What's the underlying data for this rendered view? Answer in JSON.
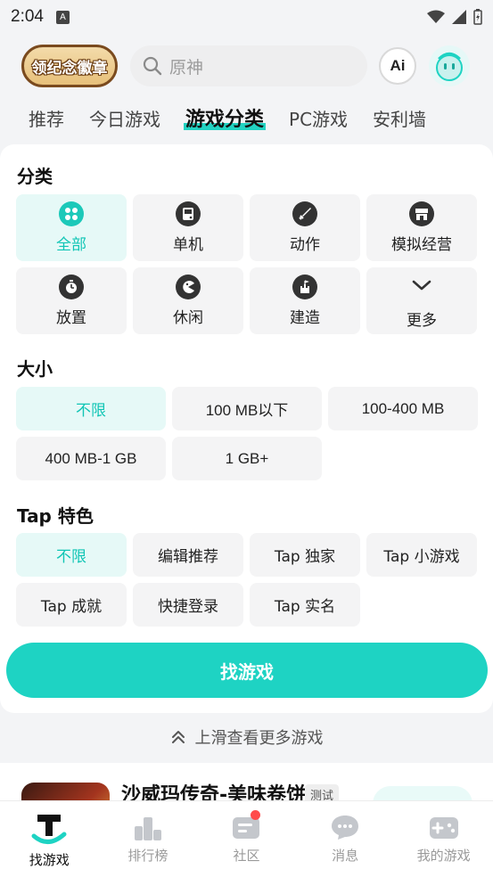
{
  "status_bar": {
    "time": "2:04"
  },
  "header": {
    "badge_label": "领纪念徽章",
    "search_placeholder": "原神",
    "ai_label": "Ai"
  },
  "tabs": [
    {
      "label": "推荐"
    },
    {
      "label": "今日游戏"
    },
    {
      "label": "游戏分类"
    },
    {
      "label": "PC游戏"
    },
    {
      "label": "安利墙"
    }
  ],
  "sections": {
    "category_title": "分类",
    "size_title": "大小",
    "tap_title": "Tap 特色"
  },
  "categories": [
    {
      "label": "全部",
      "icon": "grid-icon"
    },
    {
      "label": "单机",
      "icon": "gameboy-icon"
    },
    {
      "label": "动作",
      "icon": "sword-icon"
    },
    {
      "label": "模拟经营",
      "icon": "shop-icon"
    },
    {
      "label": "放置",
      "icon": "timer-icon"
    },
    {
      "label": "休闲",
      "icon": "pacman-icon"
    },
    {
      "label": "建造",
      "icon": "castle-icon"
    },
    {
      "label": "更多",
      "icon": "chevron-down-icon"
    }
  ],
  "sizes": [
    {
      "label": "不限"
    },
    {
      "label": "100 MB以下"
    },
    {
      "label": "100-400 MB"
    },
    {
      "label": "400 MB-1 GB"
    },
    {
      "label": "1 GB+"
    }
  ],
  "tap_features": [
    {
      "label": "不限"
    },
    {
      "label": "编辑推荐"
    },
    {
      "label": "Tap 独家"
    },
    {
      "label": "Tap 小游戏"
    },
    {
      "label": "Tap 成就"
    },
    {
      "label": "快捷登录"
    },
    {
      "label": "Tap 实名"
    }
  ],
  "find_button": "找游戏",
  "swipe_hint": "上滑查看更多游戏",
  "game_peek": {
    "title": "沙威玛传奇-美味卷饼",
    "tag": "测试"
  },
  "bottom_nav": [
    {
      "label": "找游戏"
    },
    {
      "label": "排行榜"
    },
    {
      "label": "社区"
    },
    {
      "label": "消息"
    },
    {
      "label": "我的游戏"
    }
  ],
  "colors": {
    "accent": "#1ed3c3",
    "accent_light": "#e6f9f7",
    "badge_dot": "#ff4b4b"
  }
}
